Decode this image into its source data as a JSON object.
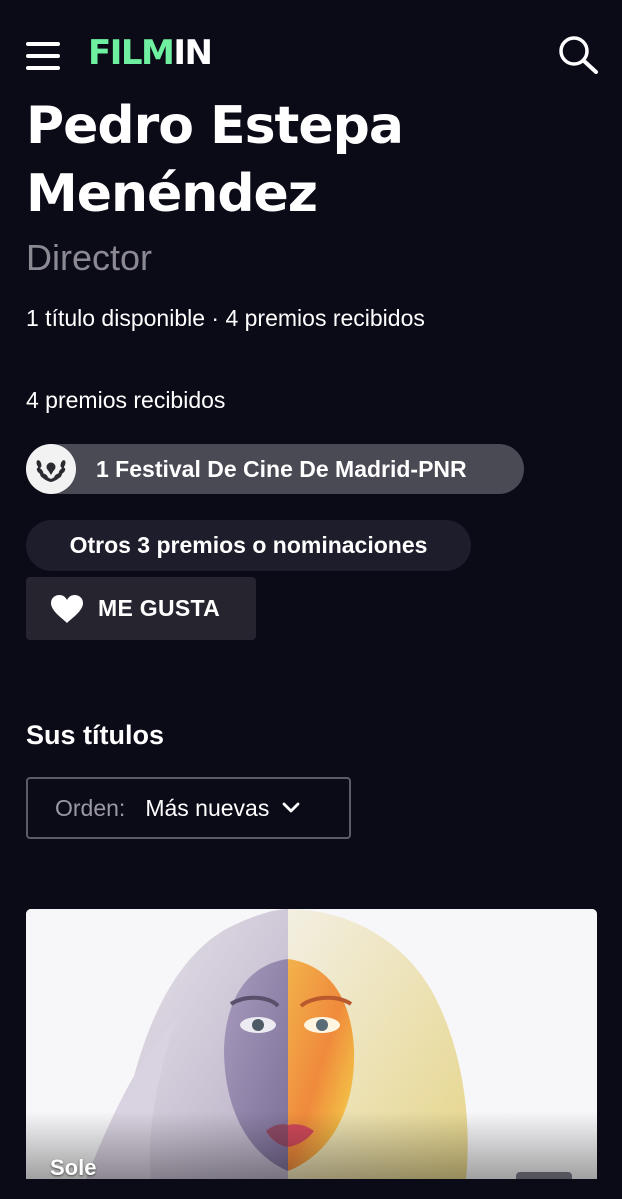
{
  "header": {
    "logo_part1": "FILM",
    "logo_part2": "IN",
    "menu_icon": "hamburger-menu-icon",
    "search_icon": "search-icon"
  },
  "person": {
    "name": "Pedro Estepa Menéndez",
    "role": "Director",
    "stats": "1 título disponible · 4 premios recibidos"
  },
  "awards": {
    "heading": "4 premios recibidos",
    "items": [
      {
        "label": "1 Festival De Cine De Madrid-PNR",
        "icon": "laurel-icon"
      }
    ],
    "others_label": "Otros 3 premios o nominaciones"
  },
  "like": {
    "label": "ME GUSTA",
    "icon": "heart-icon"
  },
  "titles": {
    "heading": "Sus títulos",
    "order_label": "Orden:",
    "order_value": "Más nuevas",
    "items": [
      {
        "title": "Sole"
      }
    ]
  },
  "colors": {
    "background": "#0b0a17",
    "brand_green": "#6ef0a0",
    "pill_grey": "#4a4a55",
    "pill_dark": "#1e1d2b",
    "muted_text": "#8b8a93"
  }
}
